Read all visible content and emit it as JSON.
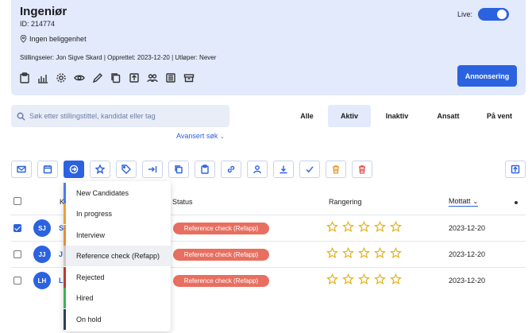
{
  "job": {
    "title": "Ingeniør",
    "id": "ID: 214774",
    "location": "Ingen beliggenhet",
    "meta": "Stillingseier: Jon Sigve Skard | Opprettet: 2023-12-20 | Utløper: Never",
    "live_label": "Live:",
    "live": true,
    "annonsering_label": "Annonsering",
    "tool_icons": [
      "clipboard-icon",
      "bar-chart-icon",
      "gear-icon",
      "eye-icon",
      "pencil-icon",
      "copy-icon",
      "share-icon",
      "users-icon",
      "newspaper-icon",
      "archive-icon"
    ]
  },
  "search": {
    "placeholder": "Søk etter stillingstittel, kandidat eller tag",
    "advanced_label": "Avansert søk"
  },
  "tabs": [
    {
      "label": "Alle",
      "active": false
    },
    {
      "label": "Aktiv",
      "active": true
    },
    {
      "label": "Inaktiv",
      "active": false
    },
    {
      "label": "Ansatt",
      "active": false
    },
    {
      "label": "På vent",
      "active": false
    }
  ],
  "toolbar": [
    "mail-icon",
    "calendar-icon",
    "move-stage-icon",
    "star-icon",
    "tag-icon",
    "arrow-to-icon",
    "copy-icon",
    "clipboard-icon",
    "link-icon",
    "user-icon",
    "download-icon",
    "check-icon",
    "trash-orange-icon",
    "trash-red-icon"
  ],
  "table": {
    "headers": {
      "status": "Status",
      "rangering": "Rangering",
      "mottatt": "Mottatt",
      "name_fragment": "K"
    },
    "rows": [
      {
        "initials": "SJ",
        "name_fragment": "S",
        "status": "Reference check (Refapp)",
        "date": "2023-12-20",
        "checked": true,
        "rating": 0
      },
      {
        "initials": "JJ",
        "name_fragment": "J",
        "status": "Reference check (Refapp)",
        "date": "2023-12-20",
        "checked": false,
        "rating": 0
      },
      {
        "initials": "LH",
        "name_fragment": "L",
        "status": "Reference check (Refapp)",
        "date": "2023-12-20",
        "checked": false,
        "rating": 0
      }
    ]
  },
  "stage_menu": [
    {
      "label": "New Candidates",
      "color": "#4a7de8"
    },
    {
      "label": "In progress",
      "color": "#e8a13b"
    },
    {
      "label": "Interview",
      "color": "#e88d3b"
    },
    {
      "label": "Reference check (Refapp)",
      "color": "#c9c9c9"
    },
    {
      "label": "Rejected",
      "color": "#c0392b"
    },
    {
      "label": "Hired",
      "color": "#3fae5b"
    },
    {
      "label": "On hold",
      "color": "#2f3e5c"
    }
  ],
  "colors": {
    "accent": "#2b62e0",
    "status_pill": "#e86f60",
    "star": "#e3b21b"
  }
}
